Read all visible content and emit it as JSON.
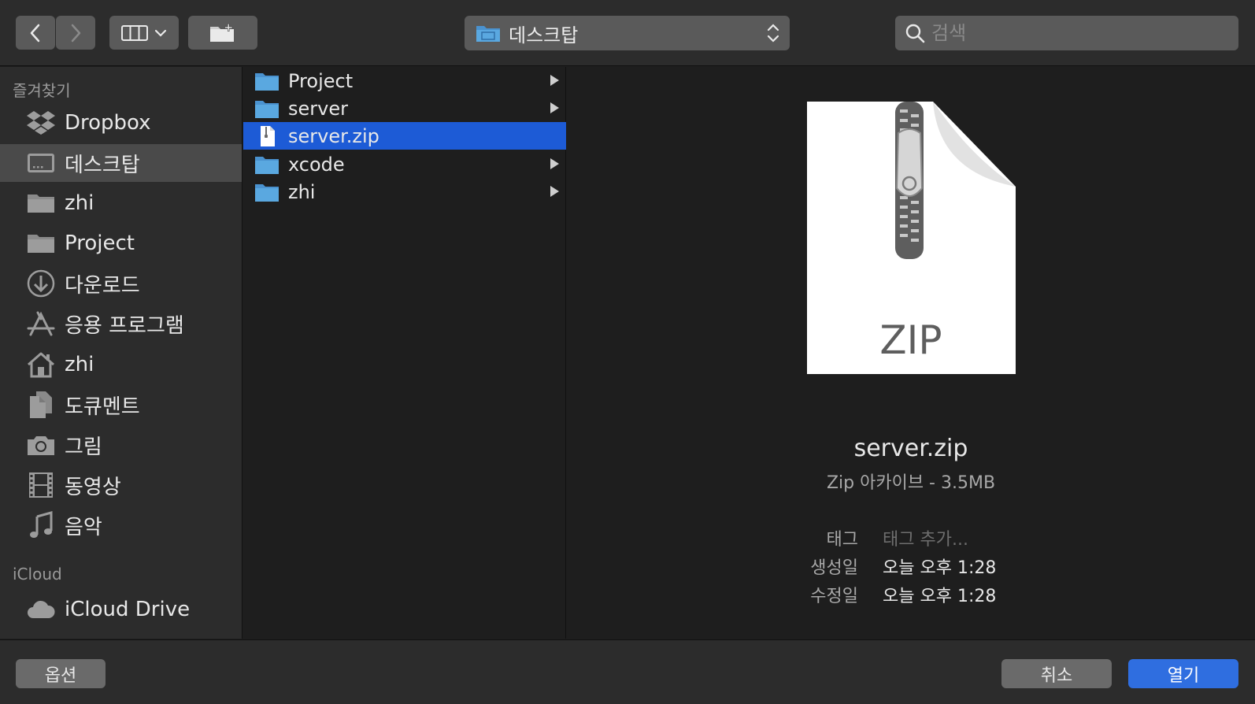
{
  "toolbar": {
    "back_icon": "chevron-left-icon",
    "forward_icon": "chevron-right-icon",
    "view_icon": "column-view-icon",
    "new_folder_icon": "new-folder-icon",
    "location": "데스크탑",
    "search_placeholder": "검색"
  },
  "sidebar": {
    "favorites_title": "즐겨찾기",
    "favorites": [
      {
        "label": "Dropbox",
        "icon": "dropbox-icon"
      },
      {
        "label": "데스크탑",
        "icon": "desktop-icon",
        "selected": true
      },
      {
        "label": "zhi",
        "icon": "folder-icon"
      },
      {
        "label": "Project",
        "icon": "folder-icon"
      },
      {
        "label": "다운로드",
        "icon": "download-icon"
      },
      {
        "label": "응용 프로그램",
        "icon": "applications-icon"
      },
      {
        "label": "zhi",
        "icon": "home-icon"
      },
      {
        "label": "도큐멘트",
        "icon": "documents-icon"
      },
      {
        "label": "그림",
        "icon": "camera-icon"
      },
      {
        "label": "동영상",
        "icon": "film-icon"
      },
      {
        "label": "음악",
        "icon": "music-icon"
      }
    ],
    "icloud_title": "iCloud",
    "icloud": [
      {
        "label": "iCloud Drive",
        "icon": "cloud-icon"
      }
    ]
  },
  "files": [
    {
      "name": "Project",
      "type": "folder"
    },
    {
      "name": "server",
      "type": "folder"
    },
    {
      "name": "server.zip",
      "type": "zip",
      "selected": true
    },
    {
      "name": "xcode",
      "type": "folder"
    },
    {
      "name": "zhi",
      "type": "folder"
    }
  ],
  "preview": {
    "doc_text": "ZIP",
    "name": "server.zip",
    "kind": "Zip 아카이브 - 3.5MB",
    "tags_label": "태그",
    "tags_placeholder": "태그 추가...",
    "created_label": "생성일",
    "created_value": "오늘 오후 1:28",
    "modified_label": "수정일",
    "modified_value": "오늘 오후 1:28"
  },
  "buttons": {
    "options": "옵션",
    "cancel": "취소",
    "open": "열기"
  },
  "colors": {
    "selection": "#1d5bd6",
    "primary_button": "#2f6ee0",
    "folder_blue": "#5aa8e0"
  }
}
